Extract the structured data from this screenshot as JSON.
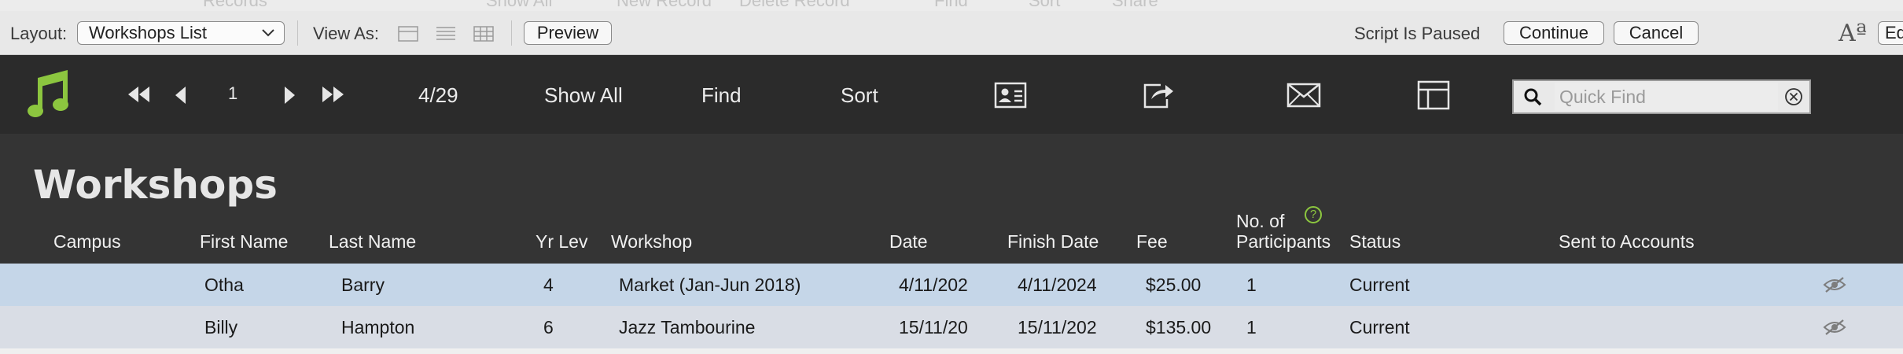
{
  "top_strip": [
    "Records",
    "Show All",
    "New Record",
    "Delete Record",
    "Find",
    "Sort",
    "Share"
  ],
  "layout_bar": {
    "layout_label": "Layout:",
    "layout_value": "Workshops List",
    "view_as_label": "View As:",
    "preview_label": "Preview",
    "script_status": "Script Is Paused",
    "continue_label": "Continue",
    "cancel_label": "Cancel",
    "font_size_glyph": "Aª",
    "edit_label": "Ed"
  },
  "toolbar": {
    "record_number": "1",
    "record_count": "4/29",
    "show_all": "Show All",
    "find": "Find",
    "sort": "Sort",
    "quick_find_placeholder": "Quick Find",
    "accent_color": "#8cc63f"
  },
  "page_title": "Workshops",
  "columns": {
    "campus": "Campus",
    "first_name": "First Name",
    "last_name": "Last Name",
    "yr_lev": "Yr Lev",
    "workshop": "Workshop",
    "date": "Date",
    "finish_date": "Finish Date",
    "fee": "Fee",
    "participants_line1": "No. of",
    "participants_line2": "Participants",
    "help_glyph": "?",
    "status": "Status",
    "sent_to_accounts": "Sent to Accounts"
  },
  "rows": [
    {
      "campus": "",
      "first_name": "Otha",
      "last_name": "Barry",
      "yr_lev": "4",
      "workshop": "Market (Jan-Jun 2018)",
      "date": "4/11/202",
      "finish_date": "4/11/2024",
      "fee": "$25.00",
      "participants": "1",
      "status": "Current",
      "sent_to_accounts": "",
      "hidden_icon": "eye-slash-icon"
    },
    {
      "campus": "",
      "first_name": "Billy",
      "last_name": "Hampton",
      "yr_lev": "6",
      "workshop": "Jazz Tambourine",
      "date": "15/11/20",
      "finish_date": "15/11/202",
      "fee": "$135.00",
      "participants": "1",
      "status": "Current",
      "sent_to_accounts": "",
      "hidden_icon": "eye-slash-icon"
    }
  ],
  "colors": {
    "row_selected": "#c5d6e8",
    "row_alt": "#d9dde5",
    "toolbar_bg": "#2b2b2b",
    "header_bg": "#343434"
  }
}
